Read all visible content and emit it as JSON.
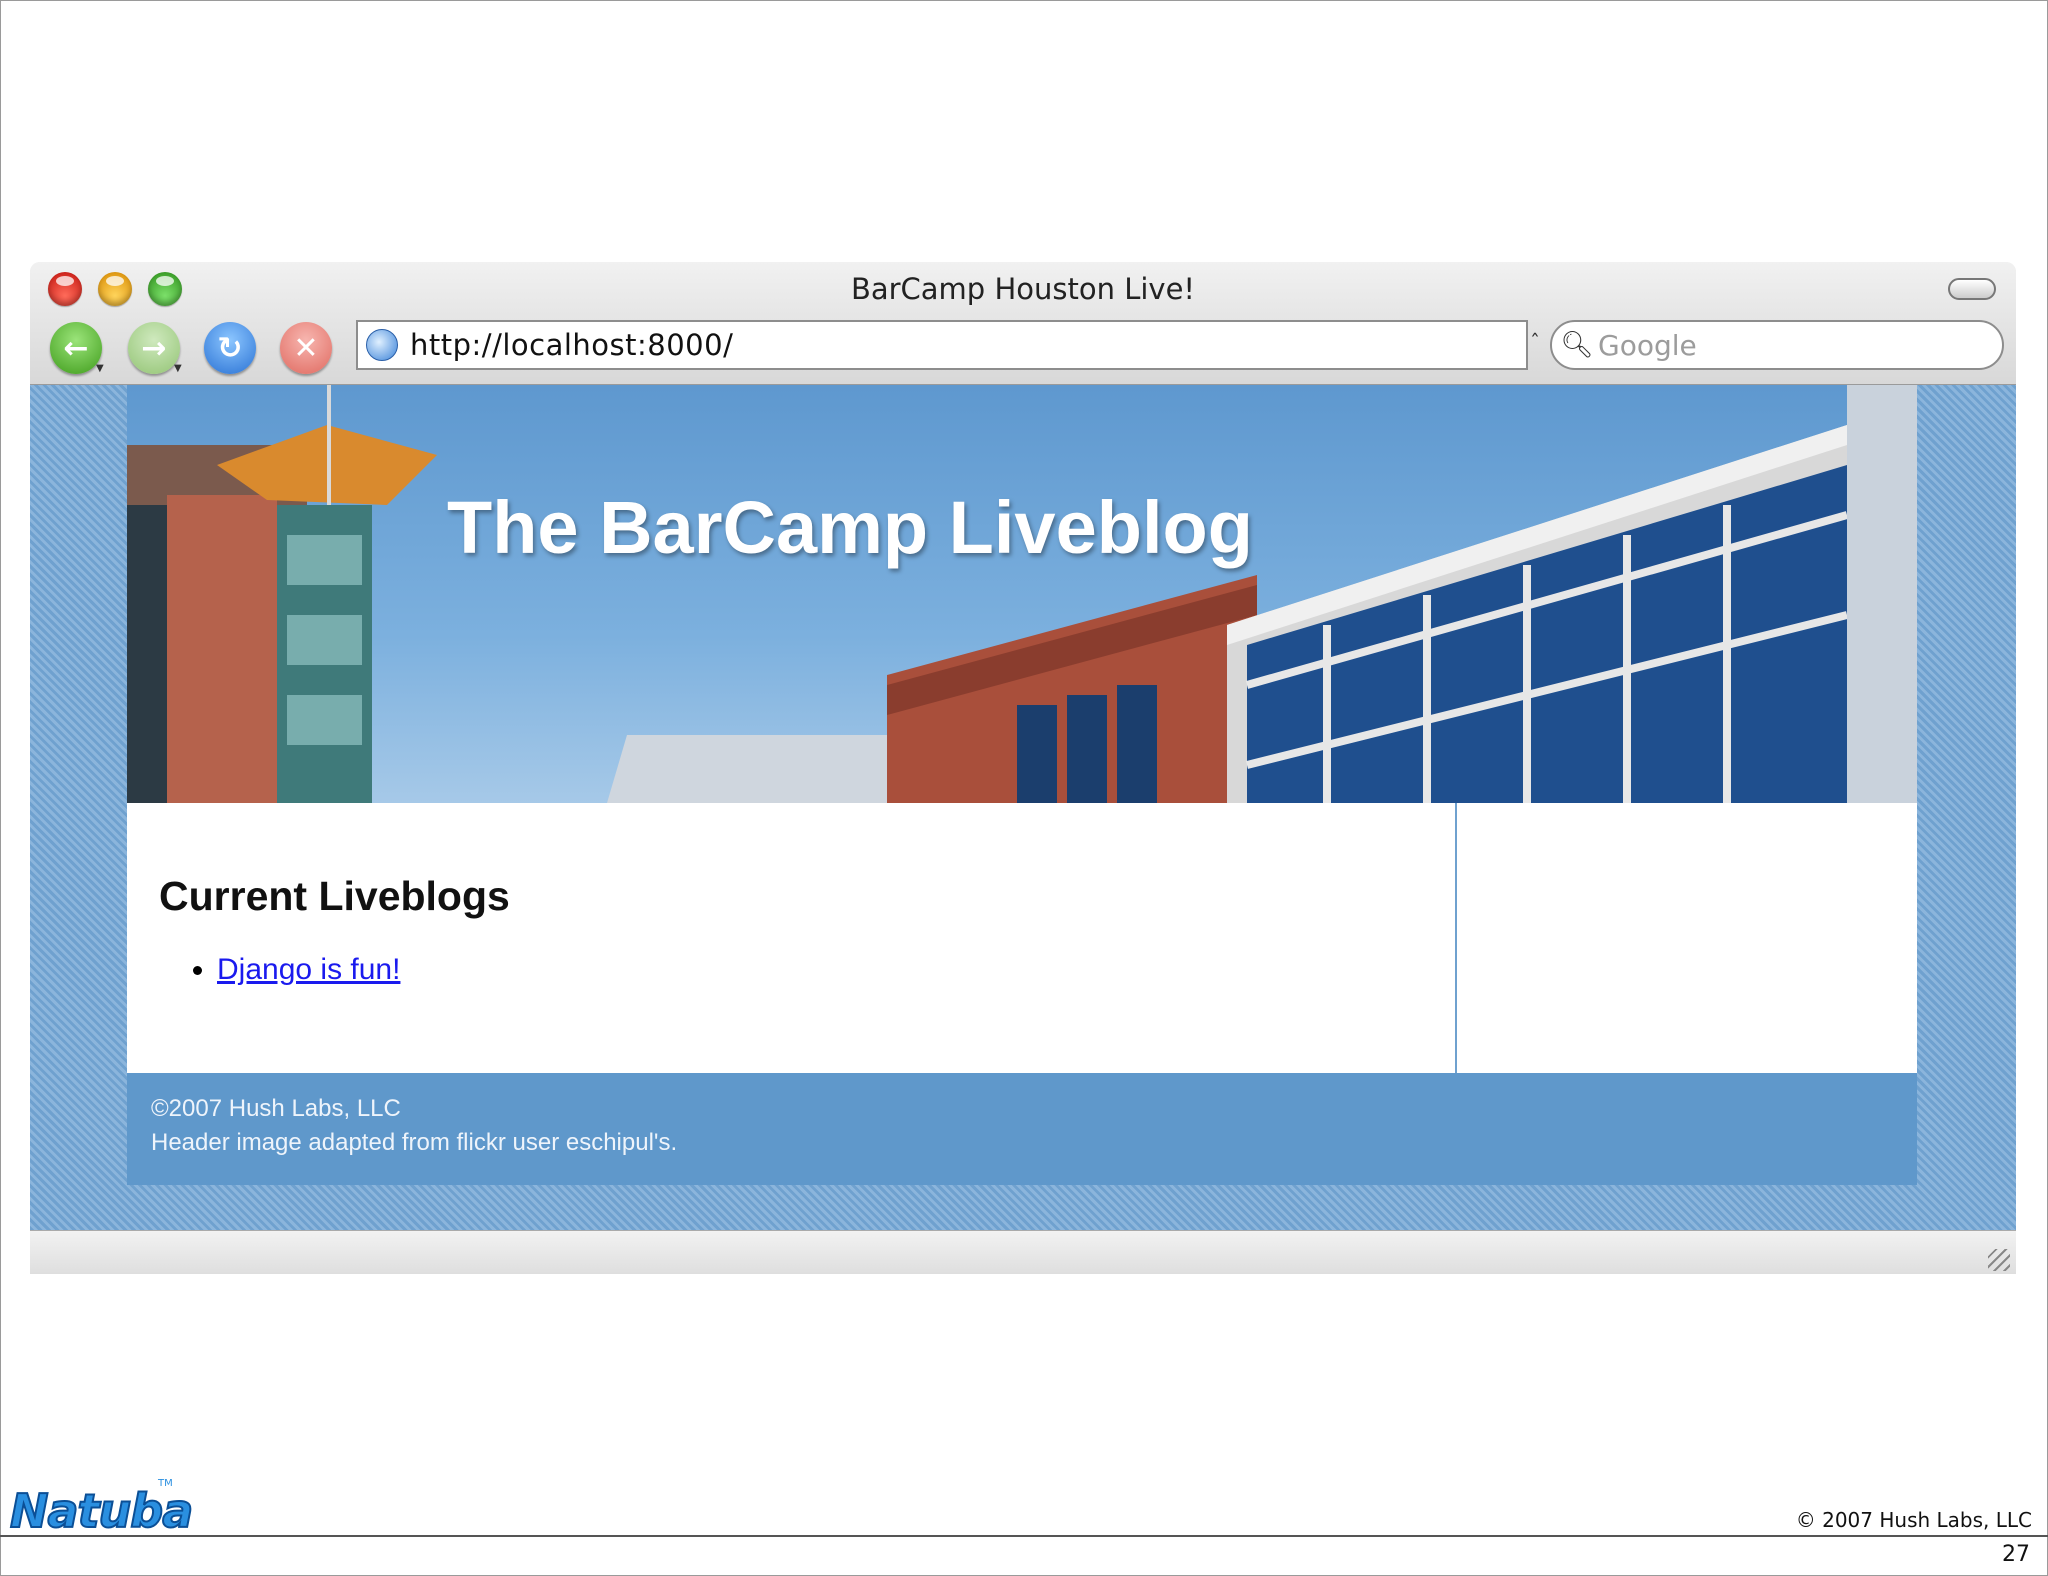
{
  "browser": {
    "window_title": "BarCamp Houston Live!",
    "url": "http://localhost:8000/",
    "search_placeholder": "Google"
  },
  "page": {
    "header_title": "The BarCamp Liveblog",
    "section_heading": "Current Liveblogs",
    "liveblogs": [
      {
        "label": "Django is fun!"
      }
    ],
    "footer": {
      "line1": "©2007 Hush Labs, LLC",
      "line2": "Header image adapted from flickr user eschipul's."
    }
  },
  "slide": {
    "logo_text": "Natuba",
    "copyright": "© 2007 Hush Labs, LLC",
    "page_number": "27"
  },
  "colors": {
    "page_background_stripe": "#6fa1cf",
    "footer_bg": "#5f98cb",
    "link": "#1a1aee"
  }
}
